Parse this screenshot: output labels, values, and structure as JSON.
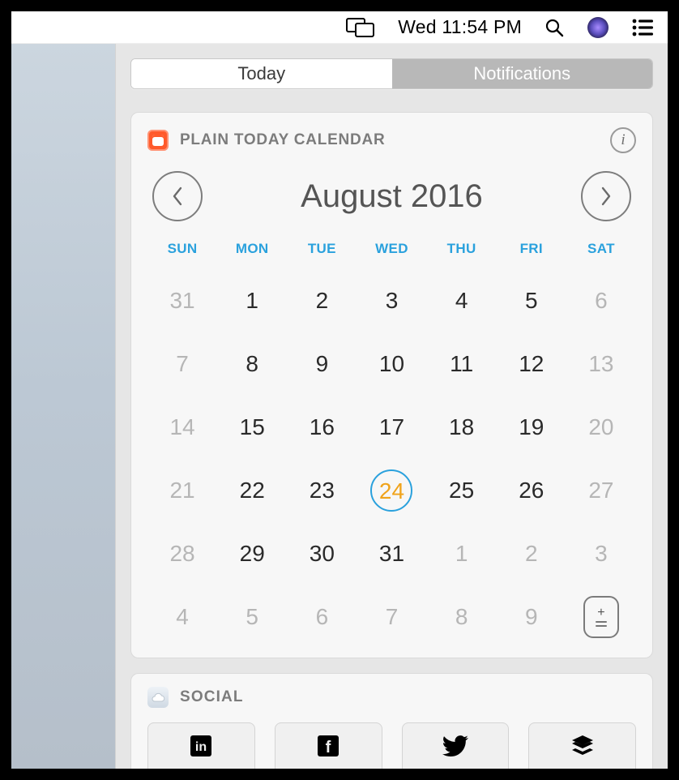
{
  "menubar": {
    "clock_text": "Wed 11:54 PM"
  },
  "nc": {
    "tabs": {
      "today": "Today",
      "notifications": "Notifications"
    },
    "active_tab": "today"
  },
  "calendar": {
    "widget_title": "PLAIN TODAY CALENDAR",
    "month_title": "August 2016",
    "dow": [
      "SUN",
      "MON",
      "TUE",
      "WED",
      "THU",
      "FRI",
      "SAT"
    ],
    "weeks": [
      [
        {
          "n": "31",
          "out": true
        },
        {
          "n": "1"
        },
        {
          "n": "2"
        },
        {
          "n": "3"
        },
        {
          "n": "4"
        },
        {
          "n": "5"
        },
        {
          "n": "6",
          "out": true
        }
      ],
      [
        {
          "n": "7",
          "out": true
        },
        {
          "n": "8"
        },
        {
          "n": "9"
        },
        {
          "n": "10"
        },
        {
          "n": "11"
        },
        {
          "n": "12"
        },
        {
          "n": "13",
          "out": true
        }
      ],
      [
        {
          "n": "14",
          "out": true
        },
        {
          "n": "15"
        },
        {
          "n": "16"
        },
        {
          "n": "17"
        },
        {
          "n": "18"
        },
        {
          "n": "19"
        },
        {
          "n": "20",
          "out": true
        }
      ],
      [
        {
          "n": "21",
          "out": true
        },
        {
          "n": "22"
        },
        {
          "n": "23"
        },
        {
          "n": "24",
          "today": true
        },
        {
          "n": "25"
        },
        {
          "n": "26"
        },
        {
          "n": "27",
          "out": true
        }
      ],
      [
        {
          "n": "28",
          "out": true
        },
        {
          "n": "29"
        },
        {
          "n": "30"
        },
        {
          "n": "31"
        },
        {
          "n": "1",
          "out": true
        },
        {
          "n": "2",
          "out": true
        },
        {
          "n": "3",
          "out": true
        }
      ],
      [
        {
          "n": "4",
          "out": true
        },
        {
          "n": "5",
          "out": true
        },
        {
          "n": "6",
          "out": true
        },
        {
          "n": "7",
          "out": true
        },
        {
          "n": "8",
          "out": true
        },
        {
          "n": "9",
          "out": true
        },
        {
          "add": true
        }
      ]
    ]
  },
  "social": {
    "widget_title": "SOCIAL",
    "services": [
      "linkedin",
      "facebook",
      "twitter",
      "buffer"
    ]
  }
}
